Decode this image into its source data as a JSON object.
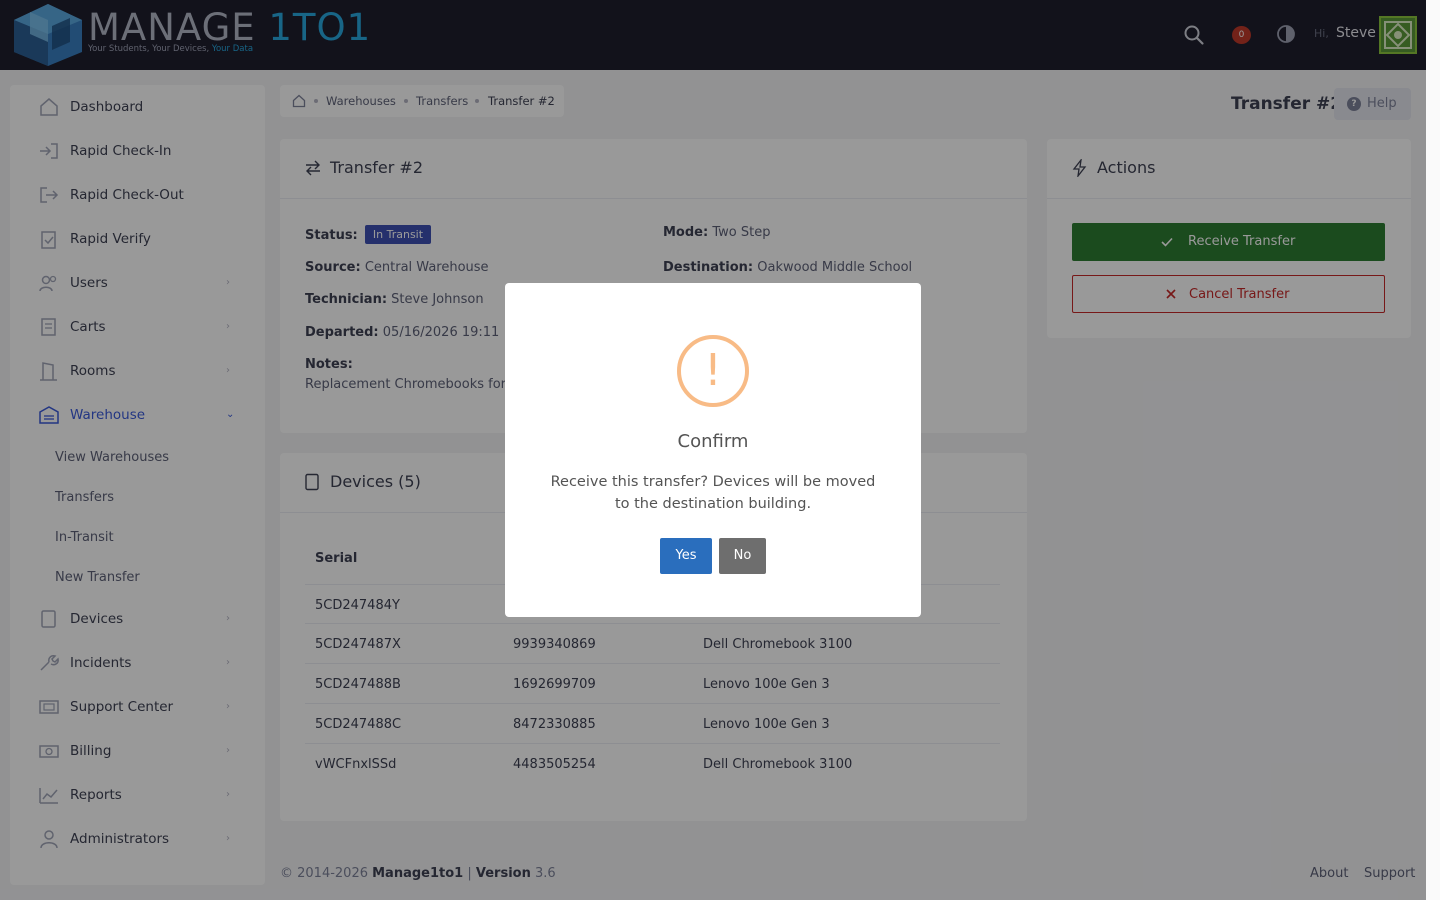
{
  "header": {
    "logo_word1": "MANAGE",
    "logo_word2": "1TO1",
    "tagline_1": "Your Students, Your Devices, ",
    "tagline_2": "Your Data",
    "notification_count": "0",
    "greeting": "Hi,",
    "user_name": "Steve",
    "icons": [
      "search-icon",
      "bell-icon",
      "theme-toggle-icon"
    ]
  },
  "sidebar": {
    "items": [
      {
        "label": "Dashboard",
        "icon": "home-icon"
      },
      {
        "label": "Rapid Check-In",
        "icon": "check-in-icon"
      },
      {
        "label": "Rapid Check-Out",
        "icon": "check-out-icon"
      },
      {
        "label": "Rapid Verify",
        "icon": "clipboard-check-icon"
      },
      {
        "label": "Users",
        "icon": "users-icon"
      },
      {
        "label": "Carts",
        "icon": "cart-icon"
      },
      {
        "label": "Rooms",
        "icon": "door-icon"
      },
      {
        "label": "Warehouse",
        "icon": "warehouse-icon"
      },
      {
        "label": "Devices",
        "icon": "tablet-icon"
      },
      {
        "label": "Incidents",
        "icon": "wrench-icon"
      },
      {
        "label": "Support Center",
        "icon": "ticket-icon"
      },
      {
        "label": "Billing",
        "icon": "money-icon"
      },
      {
        "label": "Reports",
        "icon": "chart-icon"
      },
      {
        "label": "Administrators",
        "icon": "admin-icon"
      }
    ],
    "warehouse_sub": [
      "View Warehouses",
      "Transfers",
      "In-Transit",
      "New Transfer"
    ]
  },
  "breadcrumb": [
    "Warehouses",
    "Transfers",
    "Transfer #2"
  ],
  "page": {
    "title": "Transfer #2",
    "help_label": "Help"
  },
  "transfer": {
    "card_title": "Transfer #2",
    "status_label": "Status:",
    "status_value": "In Transit",
    "mode_label": "Mode:",
    "mode_value": "Two Step",
    "source_label": "Source:",
    "source_value": "Central Warehouse",
    "destination_label": "Destination:",
    "destination_value": "Oakwood Middle School",
    "technician_label": "Technician:",
    "technician_value": "Steve Johnson",
    "departed_label": "Departed:",
    "departed_value": "05/16/2026 19:11",
    "notes_label": "Notes:",
    "notes_value": "Replacement Chromebooks for"
  },
  "actions": {
    "title": "Actions",
    "receive_label": "Receive Transfer",
    "cancel_label": "Cancel Transfer"
  },
  "devices": {
    "title": "Devices (5)",
    "columns": [
      "Serial"
    ],
    "rows": [
      {
        "serial": "5CD247484Y",
        "asset": "",
        "model": ""
      },
      {
        "serial": "5CD247487X",
        "asset": "9939340869",
        "model": "Dell Chromebook 3100"
      },
      {
        "serial": "5CD247488B",
        "asset": "1692699709",
        "model": "Lenovo 100e Gen 3"
      },
      {
        "serial": "5CD247488C",
        "asset": "8472330885",
        "model": "Lenovo 100e Gen 3"
      },
      {
        "serial": "vWCFnxlSSd",
        "asset": "4483505254",
        "model": "Dell Chromebook 3100"
      }
    ]
  },
  "footer": {
    "copyright": "© 2014-2026 ",
    "brand": "Manage1to1",
    "separator": " | ",
    "version_label": "Version",
    "version_value": " 3.6",
    "links": [
      "About",
      "Support"
    ]
  },
  "modal": {
    "icon": "warning-icon",
    "title": "Confirm",
    "message": "Receive this transfer? Devices will be moved to the destination building.",
    "yes_label": "Yes",
    "no_label": "No"
  },
  "colors": {
    "header_bg": "#1e1e2d",
    "primary": "#3f51b5",
    "success": "#2e7d32",
    "danger": "#c62828",
    "warning": "#f8bb86",
    "confirm_button": "#2a6ebd"
  }
}
